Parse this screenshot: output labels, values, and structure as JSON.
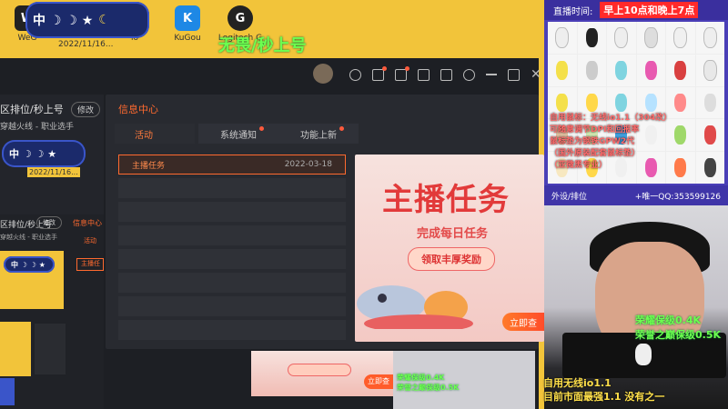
{
  "desktop": {
    "icons": [
      {
        "label": "WeG",
        "icon": "wegame-icon",
        "color": "#222"
      },
      {
        "label": "io",
        "icon": "app-icon",
        "color": "#444"
      },
      {
        "label": "KuGou",
        "icon": "kugou-icon",
        "color": "#1e88e5"
      },
      {
        "label": "Logitech G",
        "icon": "logitech-icon",
        "color": "#222"
      }
    ],
    "file_label": "2022/11/16...",
    "badge_text": "中 ☽ ☽ ★",
    "overlay_title": "无畏/秒上号"
  },
  "client": {
    "left_title": "区排位/秒上号",
    "edit_label": "修改",
    "profile_line": "穿越火线 - 职业选手",
    "message_center": {
      "title": "信息中心",
      "tabs": [
        {
          "label": "活动",
          "active": true,
          "dot": false
        },
        {
          "label": "系统通知",
          "active": false,
          "dot": true
        },
        {
          "label": "功能上新",
          "active": false,
          "dot": true
        }
      ],
      "rows": [
        {
          "title": "主播任务",
          "date": "2022-03-18",
          "active": true
        },
        {
          "title": "",
          "date": "",
          "active": false
        },
        {
          "title": "",
          "date": "",
          "active": false
        },
        {
          "title": "",
          "date": "",
          "active": false
        },
        {
          "title": "",
          "date": "",
          "active": false
        },
        {
          "title": "",
          "date": "",
          "active": false
        },
        {
          "title": "",
          "date": "",
          "active": false
        },
        {
          "title": "",
          "date": "",
          "active": false
        }
      ]
    },
    "banner": {
      "headline": "主播任务",
      "subhead": "完成每日任务",
      "pill": "领取丰厚奖励",
      "cta": "立即查"
    },
    "nested": {
      "title": "区排位/秒上号",
      "edit": "修改",
      "profile": "穿越火线 - 职业选手",
      "msg_title": "信息中心",
      "tab": "活动",
      "row": "主播任"
    }
  },
  "stream_panel": {
    "header_label": "直播时间:",
    "header_time": "早上10点和晚上7点",
    "specs": [
      "自用鼠标：无线io1.1（304改）",
      "可随意调节DPI和回报率",
      "鼠标垫为钢铁GPW2代",
      "（国外原装配套鼠标垫）",
      "（亚微黑专业）"
    ],
    "footer_left": "外设/排位",
    "footer_right": "+唯一QQ:353599126"
  },
  "cam": {
    "line1": "荣耀保级0.4K",
    "line2": "荣誉之巅保级0.5K",
    "bottom1": "自用无线io1.1",
    "bottom2": "目前市面最强1.1 没有之一"
  },
  "colors": {
    "accent": "#ff6a2f",
    "desktop_bg": "#f2c43a",
    "panel_bg": "#4a3fb7"
  }
}
